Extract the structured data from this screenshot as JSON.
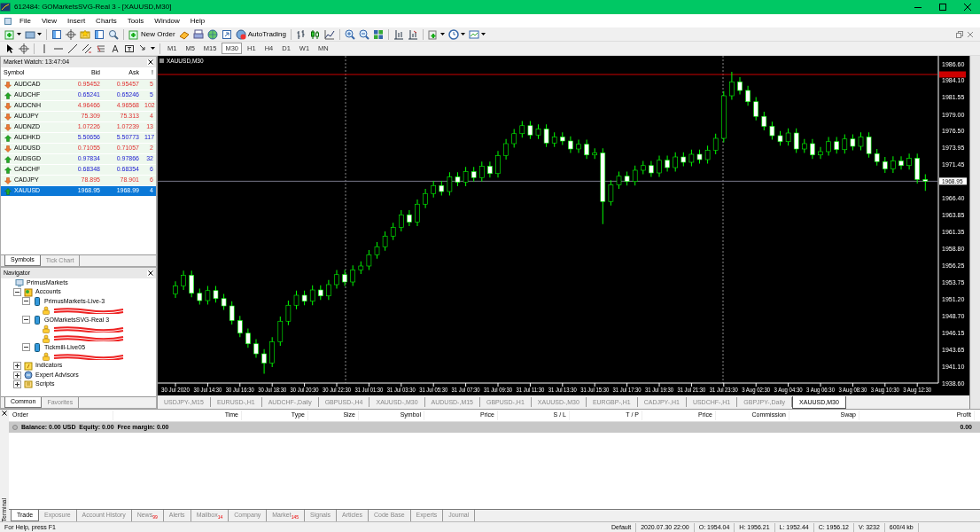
{
  "window": {
    "title": "612484: GOMarketsSVG-Real 3 - [XAUUSD,M30]"
  },
  "menu": [
    "File",
    "View",
    "Insert",
    "Charts",
    "Tools",
    "Window",
    "Help"
  ],
  "toolbar": {
    "new_order": "New Order",
    "auto_trading": "AutoTrading"
  },
  "timeframes": [
    {
      "label": "M1",
      "selected": false
    },
    {
      "label": "M5",
      "selected": false
    },
    {
      "label": "M15",
      "selected": false
    },
    {
      "label": "M30",
      "selected": true
    },
    {
      "label": "H1",
      "selected": false
    },
    {
      "label": "H4",
      "selected": false
    },
    {
      "label": "D1",
      "selected": false
    },
    {
      "label": "W1",
      "selected": false
    },
    {
      "label": "MN",
      "selected": false
    }
  ],
  "market_watch": {
    "title": "Market Watch: 13:47:04",
    "columns": [
      "Symbol",
      "Bid",
      "Ask",
      "!"
    ],
    "rows": [
      {
        "symbol": "AUDCAD",
        "bid": "0.95452",
        "ask": "0.95457",
        "spread": "5",
        "kind": "down",
        "selected": false
      },
      {
        "symbol": "AUDCHF",
        "bid": "0.65241",
        "ask": "0.65246",
        "spread": "5",
        "kind": "up",
        "selected": false
      },
      {
        "symbol": "AUDCNH",
        "bid": "4.96466",
        "ask": "4.96568",
        "spread": "102",
        "kind": "down",
        "selected": false
      },
      {
        "symbol": "AUDJPY",
        "bid": "75.309",
        "ask": "75.313",
        "spread": "4",
        "kind": "down",
        "selected": false
      },
      {
        "symbol": "AUDNZD",
        "bid": "1.07226",
        "ask": "1.07239",
        "spread": "13",
        "kind": "down",
        "selected": false
      },
      {
        "symbol": "AUDHKD",
        "bid": "5.50656",
        "ask": "5.50773",
        "spread": "117",
        "kind": "up",
        "selected": false
      },
      {
        "symbol": "AUDUSD",
        "bid": "0.71055",
        "ask": "0.71057",
        "spread": "2",
        "kind": "down",
        "selected": false
      },
      {
        "symbol": "AUDSGD",
        "bid": "0.97834",
        "ask": "0.97866",
        "spread": "32",
        "kind": "up",
        "selected": false
      },
      {
        "symbol": "CADCHF",
        "bid": "0.68348",
        "ask": "0.68354",
        "spread": "6",
        "kind": "up",
        "selected": false
      },
      {
        "symbol": "CADJPY",
        "bid": "78.895",
        "ask": "78.901",
        "spread": "6",
        "kind": "down",
        "selected": false
      },
      {
        "symbol": "XAUUSD",
        "bid": "1968.95",
        "ask": "1968.99",
        "spread": "4",
        "kind": "up",
        "selected": true
      }
    ],
    "tabs": [
      {
        "label": "Symbols",
        "selected": true
      },
      {
        "label": "Tick Chart",
        "selected": false
      }
    ]
  },
  "navigator": {
    "title": "Navigator",
    "tree": [
      {
        "kind": "root",
        "label": "PrimusMarkets",
        "children": [
          {
            "kind": "accounts",
            "label": "Accounts",
            "expanded": true,
            "children": [
              {
                "kind": "server",
                "label": "PrimusMarkets-Live-3",
                "expanded": true,
                "children": [
                  {
                    "kind": "account",
                    "redacted": true
                  }
                ]
              },
              {
                "kind": "server",
                "label": "GOMarketsSVG-Real 3",
                "expanded": true,
                "children": [
                  {
                    "kind": "account",
                    "redacted": true
                  },
                  {
                    "kind": "account",
                    "redacted": true
                  }
                ]
              },
              {
                "kind": "server",
                "label": "Tickmill-Live05",
                "expanded": true,
                "children": [
                  {
                    "kind": "account",
                    "redacted": true
                  }
                ]
              }
            ]
          },
          {
            "kind": "indicators",
            "label": "Indicators",
            "expanded": false
          },
          {
            "kind": "experts",
            "label": "Expert Advisors",
            "expanded": false
          },
          {
            "kind": "scripts",
            "label": "Scripts",
            "expanded": false
          }
        ]
      }
    ],
    "tabs": [
      {
        "label": "Common",
        "selected": true
      },
      {
        "label": "Favorites",
        "selected": false
      }
    ]
  },
  "chart": {
    "label": "XAUUSD,M30",
    "current_price": "1968.95",
    "chart_data": {
      "type": "candlestick",
      "ylim": [
        1938.6,
        1987.8
      ],
      "ref_lines": [
        {
          "axis": "y",
          "value": 1985.0,
          "color": "#cc0000"
        },
        {
          "axis": "y",
          "value": 1968.95,
          "color": "#777788"
        }
      ],
      "yticks": [
        {
          "value": 1986.6,
          "label": "1986.60"
        },
        {
          "value": 1984.1,
          "label": "1984.10"
        },
        {
          "value": 1981.55,
          "label": "1981.55"
        },
        {
          "value": 1979.0,
          "label": "1979.00"
        },
        {
          "value": 1976.5,
          "label": "1976.50"
        },
        {
          "value": 1973.95,
          "label": "1973.95"
        },
        {
          "value": 1971.45,
          "label": "1971.45"
        },
        {
          "value": 1966.4,
          "label": "1966.40"
        },
        {
          "value": 1963.85,
          "label": "1963.85"
        },
        {
          "value": 1961.35,
          "label": "1961.35"
        },
        {
          "value": 1958.8,
          "label": "1958.80"
        },
        {
          "value": 1956.25,
          "label": "1956.25"
        },
        {
          "value": 1953.75,
          "label": "1953.75"
        },
        {
          "value": 1951.2,
          "label": "1951.20"
        },
        {
          "value": 1948.7,
          "label": "1948.70"
        },
        {
          "value": 1946.15,
          "label": "1946.15"
        },
        {
          "value": 1943.65,
          "label": "1943.65"
        },
        {
          "value": 1941.1,
          "label": "1941.10"
        },
        {
          "value": 1938.6,
          "label": "1938.60"
        }
      ],
      "categories": [
        "30 Jul 2020",
        null,
        null,
        null,
        "30 Jul 14:30",
        null,
        null,
        null,
        "30 Jul 16:30",
        null,
        null,
        null,
        "30 Jul 18:30",
        null,
        null,
        null,
        "30 Jul 20:30",
        null,
        null,
        null,
        "30 Jul 22:30",
        null,
        null,
        null,
        "31 Jul 01:30",
        null,
        null,
        null,
        "31 Jul 03:30",
        null,
        null,
        null,
        "31 Jul 05:30",
        null,
        null,
        null,
        "31 Jul 07:30",
        null,
        null,
        null,
        "31 Jul 09:30",
        null,
        null,
        null,
        "31 Jul 11:30",
        null,
        null,
        null,
        "31 Jul 13:30",
        null,
        null,
        null,
        "31 Jul 15:30",
        null,
        null,
        null,
        "31 Jul 17:30",
        null,
        null,
        null,
        "31 Jul 19:30",
        null,
        null,
        null,
        "31 Jul 21:30",
        null,
        null,
        null,
        "31 Jul 23:30",
        null,
        null,
        null,
        "3 Aug 02:30",
        null,
        null,
        null,
        "3 Aug 04:30",
        null,
        null,
        null,
        "3 Aug 06:30",
        null,
        null,
        null,
        "3 Aug 08:30",
        null,
        null,
        null,
        "3 Aug 10:30",
        null,
        null,
        null,
        "3 Aug 12:30",
        null
      ],
      "ohlc": [
        [
          1952.0,
          1953.9,
          1951.4,
          1953.2
        ],
        [
          1953.2,
          1955.5,
          1952.6,
          1954.8
        ],
        [
          1954.8,
          1955.5,
          1951.5,
          1952.1
        ],
        [
          1952.1,
          1952.8,
          1950.4,
          1951.0
        ],
        [
          1951.0,
          1953.2,
          1950.4,
          1952.5
        ],
        [
          1952.5,
          1953.2,
          1950.7,
          1951.3
        ],
        [
          1951.3,
          1952.0,
          1949.6,
          1950.2
        ],
        [
          1950.2,
          1950.9,
          1947.4,
          1948.0
        ],
        [
          1948.0,
          1948.7,
          1945.5,
          1946.1
        ],
        [
          1946.1,
          1946.8,
          1943.9,
          1944.5
        ],
        [
          1944.5,
          1945.2,
          1942.4,
          1943.0
        ],
        [
          1943.0,
          1943.7,
          1940.0,
          1941.6
        ],
        [
          1941.6,
          1945.5,
          1941.0,
          1944.8
        ],
        [
          1944.8,
          1948.6,
          1944.2,
          1947.9
        ],
        [
          1947.9,
          1951.0,
          1947.3,
          1950.3
        ],
        [
          1950.3,
          1952.5,
          1949.7,
          1951.8
        ],
        [
          1951.8,
          1952.5,
          1950.3,
          1950.9
        ],
        [
          1950.9,
          1953.3,
          1950.3,
          1952.6
        ],
        [
          1952.6,
          1953.3,
          1951.1,
          1951.7
        ],
        [
          1951.7,
          1954.1,
          1951.1,
          1953.4
        ],
        [
          1953.4,
          1955.6,
          1952.8,
          1954.9
        ],
        [
          1954.9,
          1955.6,
          1953.2,
          1953.8
        ],
        [
          1953.8,
          1956.3,
          1953.2,
          1955.6
        ],
        [
          1955.6,
          1956.9,
          1955.0,
          1956.2
        ],
        [
          1956.2,
          1958.6,
          1955.6,
          1957.9
        ],
        [
          1957.9,
          1959.8,
          1957.3,
          1959.1
        ],
        [
          1959.1,
          1961.4,
          1958.5,
          1960.7
        ],
        [
          1960.7,
          1962.7,
          1960.1,
          1962.0
        ],
        [
          1962.0,
          1964.6,
          1961.4,
          1963.9
        ],
        [
          1963.9,
          1964.6,
          1962.2,
          1962.8
        ],
        [
          1962.8,
          1966.2,
          1962.2,
          1965.5
        ],
        [
          1965.5,
          1967.8,
          1964.9,
          1967.1
        ],
        [
          1967.1,
          1969.0,
          1966.5,
          1968.3
        ],
        [
          1968.3,
          1969.0,
          1966.8,
          1967.4
        ],
        [
          1967.4,
          1970.3,
          1966.8,
          1969.6
        ],
        [
          1969.6,
          1970.3,
          1968.2,
          1968.8
        ],
        [
          1968.8,
          1971.1,
          1968.2,
          1970.4
        ],
        [
          1970.4,
          1971.1,
          1968.9,
          1969.5
        ],
        [
          1969.5,
          1971.9,
          1968.9,
          1971.2
        ],
        [
          1971.2,
          1971.9,
          1969.5,
          1970.1
        ],
        [
          1970.1,
          1973.5,
          1969.5,
          1972.8
        ],
        [
          1972.8,
          1975.3,
          1972.2,
          1974.6
        ],
        [
          1974.6,
          1976.8,
          1974.0,
          1976.1
        ],
        [
          1976.1,
          1978.0,
          1975.5,
          1977.3
        ],
        [
          1977.3,
          1978.0,
          1975.3,
          1975.9
        ],
        [
          1975.9,
          1977.5,
          1975.3,
          1976.8
        ],
        [
          1976.8,
          1977.5,
          1974.1,
          1974.7
        ],
        [
          1974.7,
          1976.3,
          1974.1,
          1975.6
        ],
        [
          1975.6,
          1976.3,
          1974.4,
          1975.0
        ],
        [
          1975.0,
          1975.7,
          1973.2,
          1973.8
        ],
        [
          1973.8,
          1975.2,
          1973.2,
          1974.5
        ],
        [
          1974.5,
          1975.2,
          1972.3,
          1972.9
        ],
        [
          1972.9,
          1973.9,
          1972.3,
          1973.2
        ],
        [
          1973.2,
          1973.9,
          1962.5,
          1965.9
        ],
        [
          1965.9,
          1969.1,
          1965.3,
          1968.4
        ],
        [
          1968.4,
          1970.4,
          1967.8,
          1969.7
        ],
        [
          1969.7,
          1970.4,
          1968.3,
          1968.9
        ],
        [
          1968.9,
          1971.3,
          1968.3,
          1970.6
        ],
        [
          1970.6,
          1972.0,
          1970.0,
          1971.3
        ],
        [
          1971.3,
          1972.0,
          1969.6,
          1970.2
        ],
        [
          1970.2,
          1972.8,
          1969.6,
          1972.1
        ],
        [
          1972.1,
          1972.8,
          1970.4,
          1971.0
        ],
        [
          1971.0,
          1973.3,
          1970.4,
          1972.6
        ],
        [
          1972.6,
          1973.3,
          1971.2,
          1971.8
        ],
        [
          1971.8,
          1973.7,
          1971.2,
          1973.0
        ],
        [
          1973.0,
          1973.7,
          1971.6,
          1972.2
        ],
        [
          1972.2,
          1974.3,
          1971.6,
          1973.6
        ],
        [
          1973.6,
          1976.1,
          1973.0,
          1975.4
        ],
        [
          1975.4,
          1982.5,
          1974.8,
          1981.8
        ],
        [
          1981.8,
          1985.4,
          1981.2,
          1983.9
        ],
        [
          1983.9,
          1984.6,
          1982.0,
          1982.6
        ],
        [
          1982.6,
          1983.3,
          1980.3,
          1980.9
        ],
        [
          1980.9,
          1981.6,
          1978.1,
          1978.7
        ],
        [
          1978.7,
          1979.4,
          1976.6,
          1977.2
        ],
        [
          1977.2,
          1977.9,
          1975.2,
          1975.8
        ],
        [
          1975.8,
          1976.5,
          1974.3,
          1974.9
        ],
        [
          1974.9,
          1976.9,
          1974.3,
          1976.2
        ],
        [
          1976.2,
          1976.9,
          1973.2,
          1973.8
        ],
        [
          1973.8,
          1975.3,
          1973.2,
          1974.6
        ],
        [
          1974.6,
          1975.3,
          1972.3,
          1972.9
        ],
        [
          1972.9,
          1974.1,
          1972.3,
          1973.4
        ],
        [
          1973.4,
          1975.6,
          1972.8,
          1974.9
        ],
        [
          1974.9,
          1975.6,
          1973.1,
          1973.7
        ],
        [
          1973.7,
          1976.0,
          1973.1,
          1975.3
        ],
        [
          1975.3,
          1976.0,
          1973.6,
          1974.2
        ],
        [
          1974.2,
          1976.3,
          1973.6,
          1975.6
        ],
        [
          1975.6,
          1976.3,
          1972.5,
          1973.1
        ],
        [
          1973.1,
          1973.8,
          1971.3,
          1971.9
        ],
        [
          1971.9,
          1972.6,
          1970.2,
          1970.8
        ],
        [
          1970.8,
          1972.7,
          1970.2,
          1972.0
        ],
        [
          1972.0,
          1972.7,
          1970.7,
          1971.3
        ],
        [
          1971.3,
          1973.1,
          1970.7,
          1972.4
        ],
        [
          1972.4,
          1973.1,
          1968.6,
          1969.2
        ],
        [
          1969.2,
          1970.0,
          1967.5,
          1968.95
        ]
      ]
    }
  },
  "chart_tabs": [
    {
      "label": "USDJPY-,M15",
      "selected": false
    },
    {
      "label": "EURUSD-,H1",
      "selected": false
    },
    {
      "label": "AUDCHF-,Daily",
      "selected": false
    },
    {
      "label": "GBPUSD-,H4",
      "selected": false
    },
    {
      "label": "XAUUSD-,M30",
      "selected": false
    },
    {
      "label": "AUDUSD-,M15",
      "selected": false
    },
    {
      "label": "GBPUSD-,H1",
      "selected": false
    },
    {
      "label": "XAUUSD-,M30",
      "selected": false
    },
    {
      "label": "EURGBP-,H1",
      "selected": false
    },
    {
      "label": "CADJPY-,H1",
      "selected": false
    },
    {
      "label": "USDCHF-,H1",
      "selected": false
    },
    {
      "label": "GBPJPY-,Daily",
      "selected": false
    },
    {
      "label": "XAUUSD,M30",
      "selected": true
    }
  ],
  "terminal": {
    "title": "Terminal",
    "columns": [
      "Order",
      "Time",
      "Type",
      "Size",
      "Symbol",
      "Price",
      "S / L",
      "T / P",
      "Price",
      "Commission",
      "Swap",
      "Profit"
    ],
    "balance": "Balance: 0.00 USD  Equity: 0.00  Free margin: 0.00",
    "profit": "0.00",
    "tabs": [
      {
        "label": "Trade",
        "selected": true
      },
      {
        "label": "Exposure",
        "selected": false
      },
      {
        "label": "Account History",
        "selected": false
      },
      {
        "label": "News",
        "badge": "99",
        "selected": false
      },
      {
        "label": "Alerts",
        "selected": false
      },
      {
        "label": "Mailbox",
        "badge": "14",
        "selected": false
      },
      {
        "label": "Company",
        "selected": false
      },
      {
        "label": "Market",
        "badge": "145",
        "selected": false
      },
      {
        "label": "Signals",
        "selected": false
      },
      {
        "label": "Articles",
        "selected": false
      },
      {
        "label": "Code Base",
        "selected": false
      },
      {
        "label": "Experts",
        "selected": false
      },
      {
        "label": "Journal",
        "selected": false
      }
    ]
  },
  "status_bar": [
    "For Help, press F1",
    "Default",
    "2020.07.30 22:00",
    "O: 1954.04",
    "H: 1956.21",
    "L: 1952.44",
    "C: 1956.12",
    "V: 3232",
    "600/4 kb"
  ]
}
